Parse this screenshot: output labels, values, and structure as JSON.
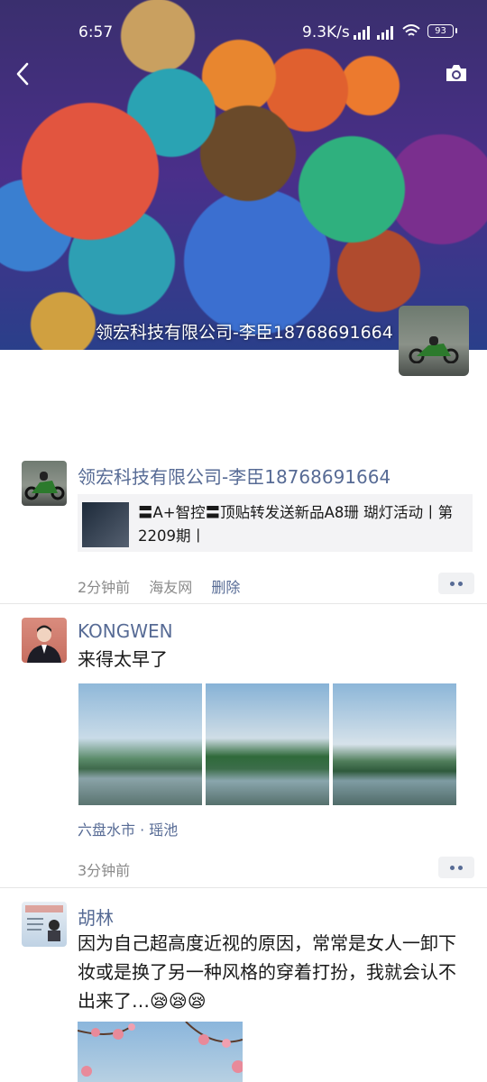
{
  "status_bar": {
    "time": "6:57",
    "network_speed": "9.3K/s",
    "battery": "93"
  },
  "header": {
    "back_icon": "chevron-left-icon",
    "camera_icon": "camera-icon",
    "cover_owner": "领宏科技有限公司-李臣18768691664"
  },
  "posts": [
    {
      "author": "领宏科技有限公司-李臣18768691664",
      "share": {
        "text": "〓A+智控〓顶贴转发送新品A8珊 瑚灯活动丨第2209期丨"
      },
      "time": "2分钟前",
      "source": "海友网",
      "delete_label": "删除"
    },
    {
      "author": "KONGWEN",
      "text": "来得太早了",
      "location": "六盘水市 · 瑶池",
      "time": "3分钟前"
    },
    {
      "author": "胡林",
      "text": "因为自己超高度近视的原因，常常是女人一卸下妆或是换了另一种风格的穿着打扮，我就会认不出来了…😪😪😪"
    }
  ]
}
